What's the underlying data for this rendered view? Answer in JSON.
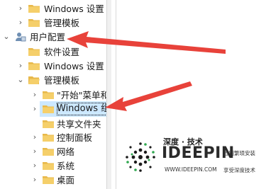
{
  "tree": {
    "items": [
      {
        "label": "Windows 设置",
        "expander": "collapsed"
      },
      {
        "label": "管理模板",
        "expander": "collapsed"
      },
      {
        "label": "用户配置",
        "expander": "expanded"
      },
      {
        "label": "软件设置",
        "expander": "none"
      },
      {
        "label": "Windows 设置",
        "expander": "collapsed"
      },
      {
        "label": "管理模板",
        "expander": "expanded"
      },
      {
        "label": "\"开始\"菜单和",
        "expander": "collapsed"
      },
      {
        "label": "Windows 组",
        "expander": "collapsed",
        "selected": true
      },
      {
        "label": "共享文件夹",
        "expander": "none"
      },
      {
        "label": "控制面板",
        "expander": "collapsed"
      },
      {
        "label": "网络",
        "expander": "collapsed"
      },
      {
        "label": "系统",
        "expander": "collapsed"
      },
      {
        "label": "桌面",
        "expander": "collapsed"
      }
    ]
  },
  "watermark": {
    "top": "深度 · 技术",
    "brand": "IDEEPIN",
    "url": "WWW.IDEEPIN.COM",
    "side1": "告别繁琐安装",
    "side2": "享受深度技术"
  },
  "colors": {
    "selection": "#cce8ff",
    "folder": "#e8b84a",
    "arrow": "#e8423a"
  }
}
